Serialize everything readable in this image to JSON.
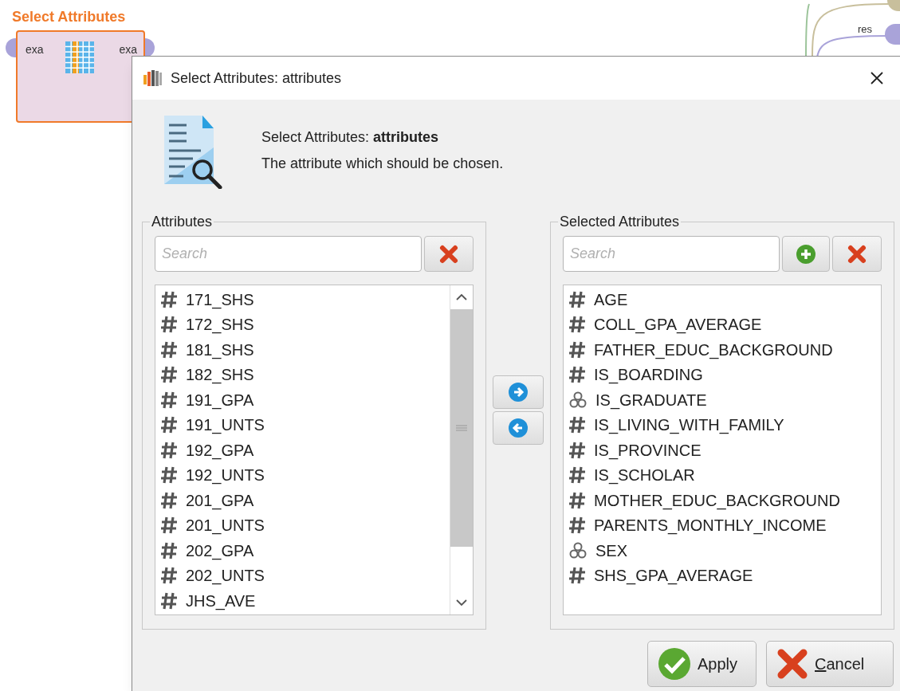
{
  "canvas": {
    "operator": {
      "title": "Select Attributes",
      "input_port": "exa",
      "output_port": "exa"
    },
    "port_label": "res"
  },
  "dialog": {
    "title": "Select Attributes: attributes",
    "header": {
      "heading": "Select Attributes: **attributes**",
      "description": "The attribute which should be chosen."
    },
    "attributes": {
      "legend": "Attributes",
      "search": {
        "placeholder": "Search"
      },
      "items": [
        {
          "kind": "numeric",
          "name": "171_SHS"
        },
        {
          "kind": "numeric",
          "name": "172_SHS"
        },
        {
          "kind": "numeric",
          "name": "181_SHS"
        },
        {
          "kind": "numeric",
          "name": "182_SHS"
        },
        {
          "kind": "numeric",
          "name": "191_GPA"
        },
        {
          "kind": "numeric",
          "name": "191_UNTS"
        },
        {
          "kind": "numeric",
          "name": "192_GPA"
        },
        {
          "kind": "numeric",
          "name": "192_UNTS"
        },
        {
          "kind": "numeric",
          "name": "201_GPA"
        },
        {
          "kind": "numeric",
          "name": "201_UNTS"
        },
        {
          "kind": "numeric",
          "name": "202_GPA"
        },
        {
          "kind": "numeric",
          "name": "202_UNTS"
        },
        {
          "kind": "numeric",
          "name": "JHS_AVE"
        }
      ]
    },
    "selected_attributes": {
      "legend": "Selected Attributes",
      "search": {
        "placeholder": "Search"
      },
      "items": [
        {
          "kind": "numeric",
          "name": "AGE"
        },
        {
          "kind": "numeric",
          "name": "COLL_GPA_AVERAGE"
        },
        {
          "kind": "numeric",
          "name": "FATHER_EDUC_BACKGROUND"
        },
        {
          "kind": "numeric",
          "name": "IS_BOARDING"
        },
        {
          "kind": "nominal",
          "name": "IS_GRADUATE"
        },
        {
          "kind": "numeric",
          "name": "IS_LIVING_WITH_FAMILY"
        },
        {
          "kind": "numeric",
          "name": "IS_PROVINCE"
        },
        {
          "kind": "numeric",
          "name": "IS_SCHOLAR"
        },
        {
          "kind": "numeric",
          "name": "MOTHER_EDUC_BACKGROUND"
        },
        {
          "kind": "numeric",
          "name": "PARENTS_MONTHLY_INCOME"
        },
        {
          "kind": "nominal",
          "name": "SEX"
        },
        {
          "kind": "numeric",
          "name": "SHS_GPA_AVERAGE"
        }
      ]
    },
    "buttons": [
      {
        "kind": "apply",
        "label": "Apply",
        "mnemonic_underlined": false
      },
      {
        "kind": "cancel",
        "label": "Cancel",
        "mnemonic_underlined": true
      }
    ]
  }
}
